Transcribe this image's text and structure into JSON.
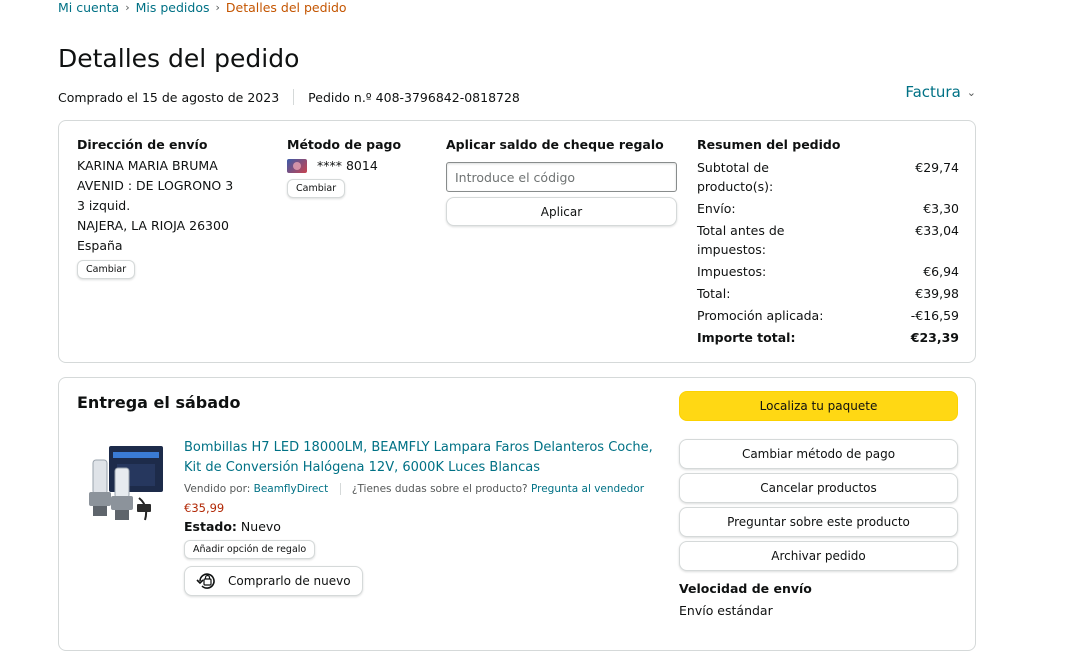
{
  "breadcrumb": {
    "items": [
      "Mi cuenta",
      "Mis pedidos"
    ],
    "current": "Detalles del pedido",
    "separator": "›"
  },
  "page": {
    "title": "Detalles del pedido",
    "purchased": "Comprado el 15 de agosto de 2023",
    "order_number": "Pedido n.º 408-3796842-0818728",
    "invoice_label": "Factura"
  },
  "shipping": {
    "title": "Dirección de envío",
    "lines": [
      "KARINA MARIA BRUMA",
      "AVENID : DE LOGRONO 3",
      "3 izquid.",
      "NAJERA, LA RIOJA 26300",
      "España"
    ],
    "change_label": "Cambiar"
  },
  "payment": {
    "title": "Método de pago",
    "card_last": "**** 8014",
    "change_label": "Cambiar"
  },
  "gift_card": {
    "title": "Aplicar saldo de cheque regalo",
    "placeholder": "Introduce el código",
    "apply_label": "Aplicar"
  },
  "summary": {
    "title": "Resumen del pedido",
    "rows": [
      {
        "label": "Subtotal de producto(s):",
        "value": "€29,74"
      },
      {
        "label": "Envío:",
        "value": "€3,30"
      },
      {
        "label": "Total antes de impuestos:",
        "value": "€33,04"
      },
      {
        "label": "Impuestos:",
        "value": "€6,94"
      },
      {
        "label": "Total:",
        "value": "€39,98"
      },
      {
        "label": "Promoción aplicada:",
        "value": "-€16,59"
      },
      {
        "label": "Importe total:",
        "value": "€23,39"
      }
    ]
  },
  "delivery": {
    "title": "Entrega el sábado",
    "product_title": "Bombillas H7 LED 18000LM, BEAMFLY Lampara Faros Delanteros Coche, Kit de Conversión Halógena 12V, 6000K Luces Blancas",
    "sold_by_label": "Vendido por:",
    "seller": "BeamflyDirect",
    "question_text": "¿Tienes dudas sobre el producto?",
    "ask_seller_label": "Pregunta al vendedor",
    "price": "€35,99",
    "state_label": "Estado:",
    "state_value": "Nuevo",
    "gift_option_label": "Añadir opción de regalo",
    "buy_again_label": "Comprarlo de nuevo"
  },
  "actions": {
    "track_label": "Localiza tu paquete",
    "change_payment_label": "Cambiar método de pago",
    "cancel_label": "Cancelar productos",
    "ask_product_label": "Preguntar sobre este producto",
    "archive_label": "Archivar pedido",
    "speed_title": "Velocidad de envío",
    "speed_value": "Envío estándar"
  }
}
